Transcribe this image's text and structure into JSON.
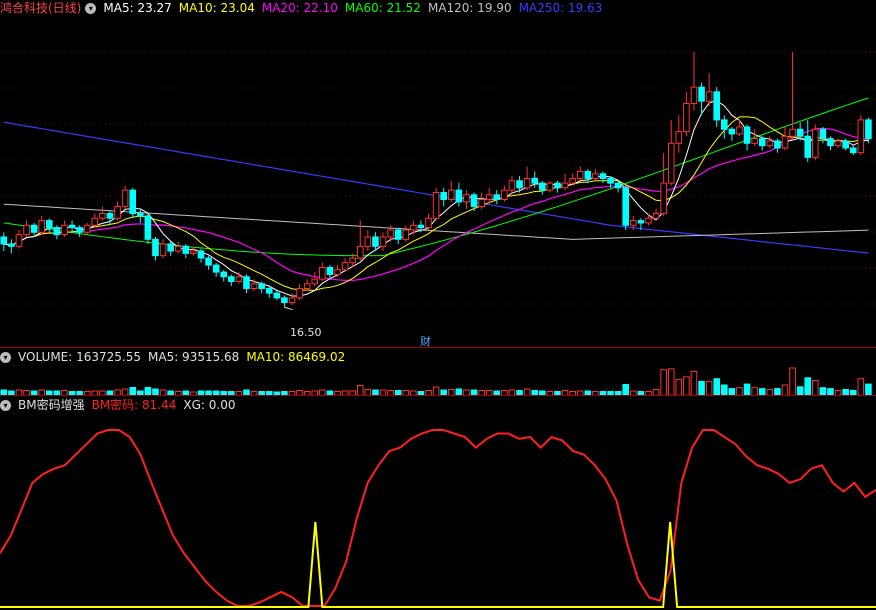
{
  "header": {
    "title": "鸿合科技(日线)",
    "ma": [
      {
        "label": "MA5: 23.27",
        "color": "#ffffff"
      },
      {
        "label": "MA10: 23.04",
        "color": "#ffff00"
      },
      {
        "label": "MA20: 22.10",
        "color": "#ff00ff"
      },
      {
        "label": "MA60: 21.52",
        "color": "#00ff00"
      },
      {
        "label": "MA120: 19.90",
        "color": "#c0c0c0"
      },
      {
        "label": "MA250: 19.63",
        "color": "#3a3aff"
      }
    ]
  },
  "price_panel": {
    "low_marker": "16.50",
    "finance_marker": "财",
    "price_range": [
      15.2,
      27.5
    ],
    "candles": [
      [
        19.6,
        19.3,
        19.8,
        19.0
      ],
      [
        19.3,
        19.2,
        19.5,
        18.9
      ],
      [
        19.2,
        19.7,
        19.9,
        19.1
      ],
      [
        19.7,
        20.1,
        20.3,
        19.6
      ],
      [
        20.1,
        19.8,
        20.2,
        19.6
      ],
      [
        19.8,
        20.3,
        20.5,
        19.7
      ],
      [
        20.3,
        20.0,
        20.4,
        19.8
      ],
      [
        20.0,
        19.7,
        20.1,
        19.5
      ],
      [
        19.7,
        20.1,
        20.3,
        19.6
      ],
      [
        20.1,
        20.0,
        20.3,
        19.8
      ],
      [
        20.0,
        19.8,
        20.1,
        19.6
      ],
      [
        19.8,
        20.1,
        20.2,
        19.7
      ],
      [
        20.1,
        20.4,
        20.6,
        20.0
      ],
      [
        20.4,
        20.6,
        20.9,
        20.3
      ],
      [
        20.6,
        20.4,
        20.7,
        20.1
      ],
      [
        20.4,
        20.9,
        21.1,
        20.3
      ],
      [
        20.9,
        21.6,
        21.8,
        20.8
      ],
      [
        21.6,
        20.6,
        21.7,
        20.4
      ],
      [
        20.6,
        20.5,
        20.8,
        20.2
      ],
      [
        20.5,
        19.5,
        20.6,
        19.3
      ],
      [
        19.5,
        18.8,
        19.6,
        18.6
      ],
      [
        18.8,
        19.3,
        19.5,
        18.7
      ],
      [
        19.3,
        19.0,
        19.4,
        18.8
      ],
      [
        19.0,
        19.2,
        19.4,
        18.9
      ],
      [
        19.2,
        18.9,
        19.3,
        18.7
      ],
      [
        18.9,
        19.0,
        19.2,
        18.8
      ],
      [
        19.0,
        18.7,
        19.1,
        18.5
      ],
      [
        18.7,
        18.4,
        18.8,
        18.2
      ],
      [
        18.4,
        18.1,
        18.5,
        17.9
      ],
      [
        18.1,
        17.9,
        18.2,
        17.7
      ],
      [
        17.9,
        17.7,
        18.0,
        17.5
      ],
      [
        17.7,
        17.9,
        18.1,
        17.6
      ],
      [
        17.9,
        17.4,
        18.0,
        17.2
      ],
      [
        17.4,
        17.6,
        17.8,
        17.3
      ],
      [
        17.6,
        17.4,
        17.7,
        17.2
      ],
      [
        17.4,
        17.2,
        17.5,
        17.0
      ],
      [
        17.2,
        17.0,
        17.3,
        16.9
      ],
      [
        17.0,
        16.8,
        17.1,
        16.6
      ],
      [
        16.8,
        17.0,
        17.2,
        16.7
      ],
      [
        17.0,
        17.4,
        17.6,
        16.9
      ],
      [
        17.4,
        17.6,
        17.8,
        17.3
      ],
      [
        17.6,
        17.8,
        18.1,
        17.5
      ],
      [
        17.8,
        18.3,
        18.5,
        17.7
      ],
      [
        18.3,
        18.0,
        18.4,
        17.8
      ],
      [
        18.0,
        18.2,
        18.4,
        17.9
      ],
      [
        18.2,
        18.5,
        18.7,
        18.1
      ],
      [
        18.5,
        18.7,
        18.9,
        18.3
      ],
      [
        18.7,
        19.2,
        20.3,
        18.6
      ],
      [
        19.2,
        19.6,
        19.9,
        19.0
      ],
      [
        19.6,
        19.2,
        19.8,
        19.0
      ],
      [
        19.2,
        19.6,
        19.8,
        19.0
      ],
      [
        19.6,
        19.9,
        20.1,
        19.4
      ],
      [
        19.9,
        19.5,
        20.0,
        19.3
      ],
      [
        19.5,
        19.9,
        20.1,
        19.4
      ],
      [
        19.9,
        20.1,
        20.3,
        19.7
      ],
      [
        20.1,
        20.0,
        20.3,
        19.8
      ],
      [
        20.0,
        20.4,
        20.6,
        19.9
      ],
      [
        20.4,
        21.5,
        21.7,
        20.3
      ],
      [
        21.5,
        21.2,
        21.7,
        20.9
      ],
      [
        21.2,
        21.6,
        22.0,
        21.1
      ],
      [
        21.6,
        21.1,
        21.9,
        20.9
      ],
      [
        21.1,
        21.4,
        21.6,
        20.8
      ],
      [
        21.4,
        20.9,
        21.5,
        20.7
      ],
      [
        20.9,
        21.2,
        21.5,
        20.8
      ],
      [
        21.2,
        21.4,
        21.7,
        21.0
      ],
      [
        21.4,
        21.2,
        21.6,
        21.0
      ],
      [
        21.2,
        21.6,
        21.8,
        21.1
      ],
      [
        21.6,
        22.0,
        22.2,
        21.4
      ],
      [
        22.0,
        21.7,
        22.2,
        21.5
      ],
      [
        21.7,
        22.1,
        22.6,
        21.6
      ],
      [
        22.1,
        21.9,
        22.4,
        21.7
      ],
      [
        21.9,
        21.6,
        22.0,
        21.4
      ],
      [
        21.6,
        21.9,
        22.0,
        21.5
      ],
      [
        21.9,
        21.7,
        22.0,
        21.5
      ],
      [
        21.7,
        21.9,
        22.3,
        21.6
      ],
      [
        21.9,
        22.1,
        22.3,
        21.8
      ],
      [
        22.1,
        22.4,
        22.6,
        22.0
      ],
      [
        22.4,
        22.1,
        22.5,
        21.9
      ],
      [
        22.1,
        22.3,
        22.5,
        22.0
      ],
      [
        22.3,
        22.1,
        22.4,
        21.9
      ],
      [
        22.1,
        21.9,
        22.2,
        21.7
      ],
      [
        21.9,
        21.7,
        22.0,
        21.5
      ],
      [
        21.7,
        20.1,
        21.8,
        19.9
      ],
      [
        20.1,
        20.3,
        20.5,
        19.9
      ],
      [
        20.3,
        20.2,
        20.4,
        19.9
      ],
      [
        20.2,
        20.4,
        20.6,
        20.1
      ],
      [
        20.4,
        20.6,
        20.8,
        20.3
      ],
      [
        20.6,
        21.9,
        23.2,
        20.5
      ],
      [
        21.9,
        23.6,
        24.6,
        21.8
      ],
      [
        23.6,
        24.1,
        24.8,
        23.2
      ],
      [
        24.1,
        25.3,
        25.8,
        23.9
      ],
      [
        25.3,
        26.0,
        27.5,
        25.0
      ],
      [
        26.0,
        25.4,
        26.2,
        24.8
      ],
      [
        25.4,
        25.8,
        26.6,
        25.2
      ],
      [
        25.8,
        24.6,
        26.0,
        24.3
      ],
      [
        24.6,
        24.2,
        24.8,
        23.8
      ],
      [
        24.2,
        24.0,
        24.3,
        23.7
      ],
      [
        24.0,
        24.3,
        24.6,
        23.9
      ],
      [
        24.3,
        23.6,
        24.4,
        23.3
      ],
      [
        23.6,
        23.8,
        24.2,
        23.5
      ],
      [
        23.8,
        23.5,
        23.9,
        23.3
      ],
      [
        23.5,
        23.7,
        23.9,
        23.4
      ],
      [
        23.7,
        23.4,
        23.8,
        23.2
      ],
      [
        23.4,
        23.9,
        24.3,
        23.3
      ],
      [
        23.9,
        24.2,
        27.5,
        23.8
      ],
      [
        24.2,
        23.9,
        24.5,
        23.7
      ],
      [
        23.9,
        23.0,
        24.6,
        22.8
      ],
      [
        23.0,
        24.2,
        24.4,
        22.9
      ],
      [
        24.2,
        23.8,
        24.3,
        23.6
      ],
      [
        23.8,
        23.5,
        23.9,
        23.3
      ],
      [
        23.5,
        23.7,
        23.8,
        23.4
      ],
      [
        23.7,
        23.4,
        23.8,
        23.3
      ],
      [
        23.4,
        23.2,
        23.5,
        23.1
      ],
      [
        23.2,
        24.6,
        24.8,
        23.1
      ],
      [
        24.6,
        23.8,
        24.7,
        23.6
      ]
    ]
  },
  "volume_panel": {
    "title": "VOLUME: 163725.55",
    "ma5": "MA5: 93515.68",
    "ma10": "MA10: 86469.02"
  },
  "indicator_panel": {
    "title": "BM密码增强",
    "bm_label": "BM密码: 81.44",
    "xg_label": "XG: 0.00",
    "bm_values": [
      30,
      40,
      55,
      70,
      75,
      78,
      80,
      86,
      92,
      98,
      100,
      100,
      96,
      86,
      70,
      55,
      40,
      30,
      22,
      14,
      8,
      3,
      0,
      0,
      2,
      5,
      8,
      5,
      0,
      0,
      0,
      10,
      25,
      50,
      70,
      80,
      88,
      90,
      95,
      98,
      100,
      100,
      98,
      96,
      90,
      95,
      98,
      98,
      95,
      96,
      90,
      96,
      94,
      88,
      86,
      80,
      72,
      60,
      35,
      15,
      5,
      3,
      20,
      70,
      90,
      100,
      100,
      96,
      92,
      85,
      80,
      78,
      75,
      70,
      72,
      78,
      80,
      70,
      65,
      70,
      62,
      66
    ],
    "xg_spikes": [
      0.36,
      0.765
    ]
  },
  "colors": {
    "up": "#ff3232",
    "down": "#00ffff",
    "bm_line": "#ff2020",
    "xg_line": "#ffff00",
    "grid": "#800000"
  }
}
